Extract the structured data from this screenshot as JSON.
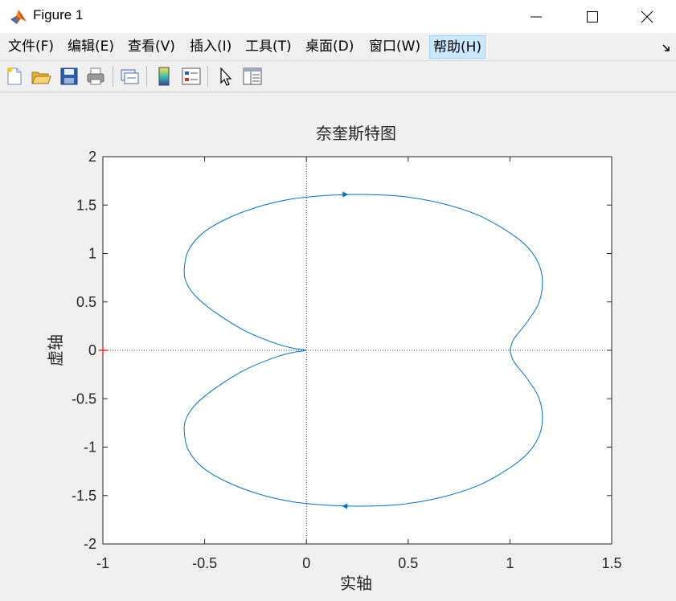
{
  "window": {
    "title": "Figure 1",
    "controls": [
      "minimize",
      "maximize",
      "close"
    ]
  },
  "menubar": {
    "items": [
      {
        "label": "文件(F)"
      },
      {
        "label": "编辑(E)"
      },
      {
        "label": "查看(V)"
      },
      {
        "label": "插入(I)"
      },
      {
        "label": "工具(T)"
      },
      {
        "label": "桌面(D)"
      },
      {
        "label": "窗口(W)"
      },
      {
        "label": "帮助(H)",
        "active": true
      }
    ]
  },
  "toolbar": {
    "buttons": [
      "new-figure-icon",
      "open-file-icon",
      "save-icon",
      "print-icon",
      "link-plot-icon",
      "colorbar-icon",
      "legend-icon",
      "pointer-icon",
      "property-editor-icon"
    ]
  },
  "colors": {
    "curve": "#0072bd",
    "origin_marker": "#ff0000",
    "reference_lines": "#000000",
    "active_menu": "#cce8ff"
  },
  "chart_data": {
    "type": "line",
    "title": "奈奎斯特图",
    "xlabel": "实轴",
    "ylabel": "虚轴",
    "xlim": [
      -1,
      1.5
    ],
    "ylim": [
      -2,
      2
    ],
    "xticks": [
      -1,
      -0.5,
      0,
      0.5,
      1,
      1.5
    ],
    "yticks": [
      -2,
      -1.5,
      -1,
      -0.5,
      0,
      0.5,
      1,
      1.5,
      2
    ],
    "xtick_labels": [
      "-1",
      "-0.5",
      "0",
      "0.5",
      "1",
      "1.5"
    ],
    "ytick_labels": [
      "-2",
      "-1.5",
      "-1",
      "-0.5",
      "0",
      "0.5",
      "1",
      "1.5",
      "2"
    ],
    "grid": false,
    "reference_lines": {
      "x": 0,
      "y": 0,
      "style": "dotted"
    },
    "critical_point": {
      "x": -1,
      "y": 0,
      "marker": "+"
    },
    "series": [
      {
        "values": [
          [
            1.0,
            0.0
          ],
          [
            1.02,
            0.12
          ],
          [
            1.08,
            0.28
          ],
          [
            1.14,
            0.48
          ],
          [
            1.16,
            0.7
          ],
          [
            1.14,
            0.9
          ],
          [
            1.08,
            1.08
          ],
          [
            0.98,
            1.24
          ],
          [
            0.84,
            1.4
          ],
          [
            0.66,
            1.52
          ],
          [
            0.47,
            1.59
          ],
          [
            0.27,
            1.61
          ],
          [
            0.1,
            1.6
          ],
          [
            -0.08,
            1.56
          ],
          [
            -0.24,
            1.48
          ],
          [
            -0.39,
            1.36
          ],
          [
            -0.51,
            1.21
          ],
          [
            -0.58,
            1.03
          ],
          [
            -0.6,
            0.84
          ],
          [
            -0.59,
            0.7
          ],
          [
            -0.54,
            0.55
          ],
          [
            -0.44,
            0.38
          ],
          [
            -0.3,
            0.2
          ],
          [
            -0.15,
            0.07
          ],
          [
            -0.06,
            0.02
          ],
          [
            0.0,
            0.0
          ]
        ],
        "mirrored": true
      }
    ],
    "direction_arrows": [
      {
        "x": 0.19,
        "y": 1.61,
        "direction": "right"
      },
      {
        "x": 0.19,
        "y": -1.61,
        "direction": "left"
      }
    ]
  }
}
